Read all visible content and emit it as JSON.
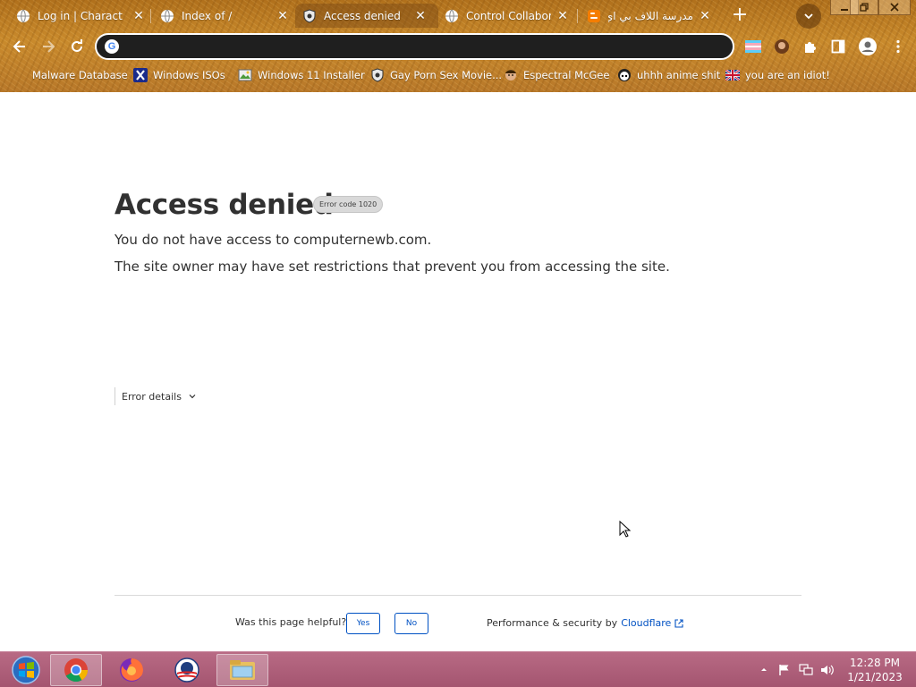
{
  "browser": {
    "tabs": [
      {
        "title": "Log in | Character",
        "icon": "globe-icon",
        "active": false
      },
      {
        "title": "Index of /",
        "icon": "globe-icon",
        "active": false
      },
      {
        "title": "Access denied",
        "icon": "shield-icon",
        "active": true
      },
      {
        "title": "Control Collaborat",
        "icon": "globe-icon",
        "active": false
      },
      {
        "title": "مدرسة اللاف بي اي",
        "icon": "blogger-icon",
        "active": false
      }
    ],
    "new_tab_label": "+",
    "omnibox": {
      "value": "",
      "placeholder": ""
    },
    "bookmarks": [
      {
        "label": "Malware Database"
      },
      {
        "label": "Windows ISOs"
      },
      {
        "label": "Windows 11 Installer"
      },
      {
        "label": "Gay Porn Sex Movie..."
      },
      {
        "label": "Espectral McGee"
      },
      {
        "label": "uhhh anime shit"
      },
      {
        "label": "you are an idiot!"
      }
    ]
  },
  "page": {
    "heading": "Access denied",
    "error_code": "Error code 1020",
    "line1": "You do not have access to computernewb.com.",
    "line2": "The site owner may have set restrictions that prevent you from accessing the site.",
    "details_label": "Error details",
    "helpful_question": "Was this page helpful?",
    "yes_label": "Yes",
    "no_label": "No",
    "perf_text": "Performance & security by",
    "cloudflare_label": "Cloudflare"
  },
  "taskbar": {
    "clock_time": "12:28 PM",
    "clock_date": "1/21/2023"
  },
  "colors": {
    "link_blue": "#0051c3",
    "taskbar_pink": "#a45570",
    "chrome_gold": "#c98a2c"
  }
}
